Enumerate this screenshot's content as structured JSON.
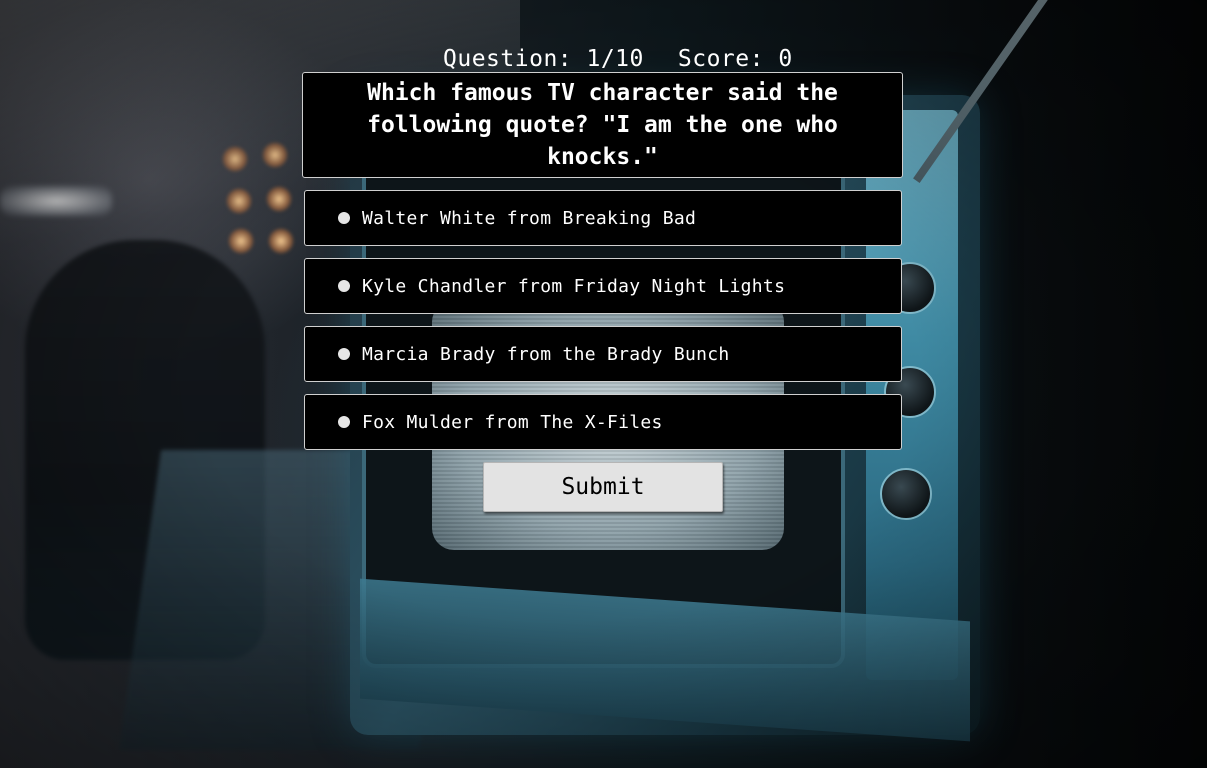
{
  "status": {
    "question_label": "Question: 1/10",
    "score_label": "Score: 0"
  },
  "question": {
    "text": "Which famous TV character said the following quote? \"I am the one who knocks.\""
  },
  "answers": [
    {
      "label": "Walter White from Breaking Bad"
    },
    {
      "label": "Kyle Chandler from Friday Night Lights"
    },
    {
      "label": "Marcia Brady from the Brady Bunch"
    },
    {
      "label": "Fox Mulder from The X-Files"
    }
  ],
  "submit": {
    "label": "Submit"
  },
  "background": {
    "icon": "retro-television-photo",
    "accent_color": "#2c5566"
  }
}
